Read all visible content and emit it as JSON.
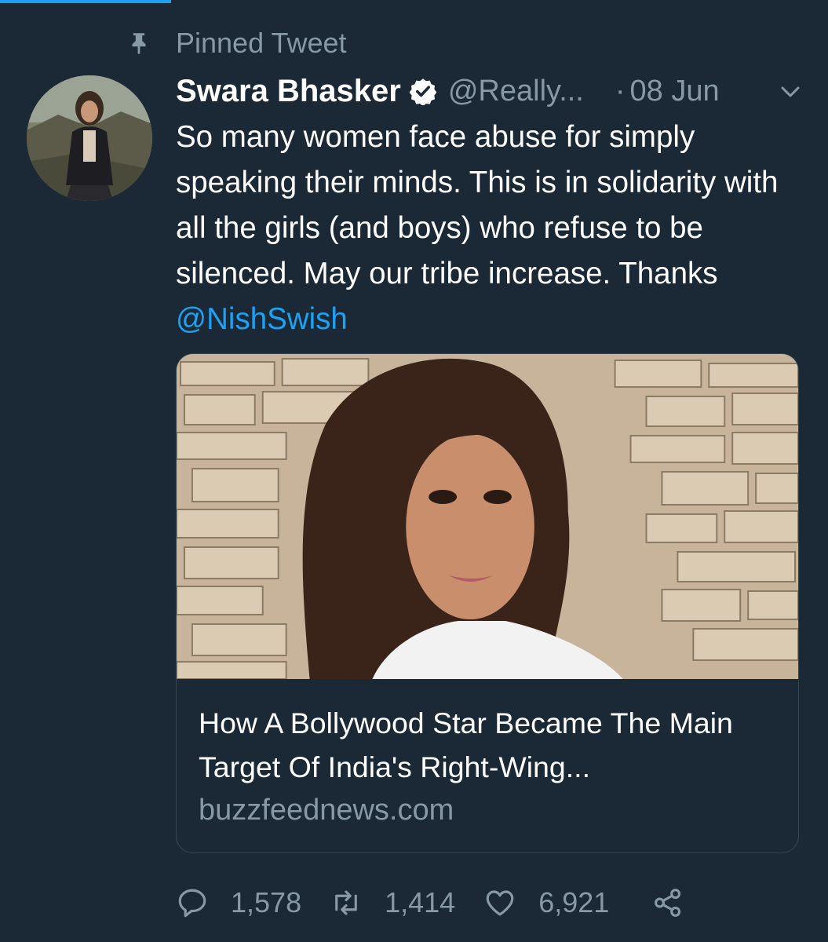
{
  "pinned_label": "Pinned Tweet",
  "author": {
    "display_name": "Swara Bhasker",
    "handle": "@Really...",
    "verified": true
  },
  "date_separator": "·",
  "date": "08 Jun",
  "tweet": {
    "text": "So many women face abuse for simply speaking their minds. This is in solidarity with all the girls (and boys) who refuse to be silenced. May our tribe increase. Thanks ",
    "mention": "@NishSwish"
  },
  "card": {
    "title": "How A Bollywood Star Became The Main Target Of India's Right-Wing...",
    "domain": "buzzfeednews.com"
  },
  "actions": {
    "replies": "1,578",
    "retweets": "1,414",
    "likes": "6,921"
  },
  "colors": {
    "background": "#1b2836",
    "accent": "#1da1f2",
    "secondary_text": "#8899a6",
    "border": "#38444d"
  }
}
